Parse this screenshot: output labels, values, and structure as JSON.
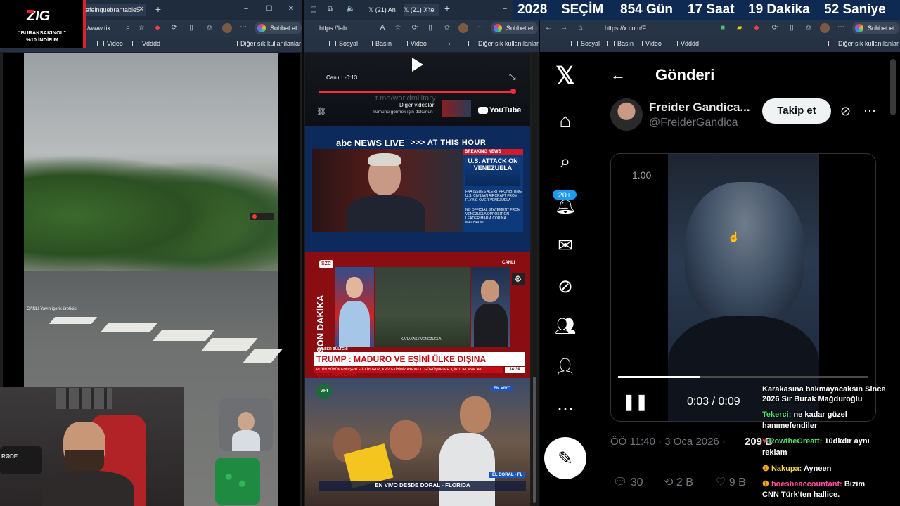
{
  "countdown": {
    "year": "2028",
    "label": "SEÇİM",
    "days": "854 Gün",
    "hours": "17 Saat",
    "minutes": "19 Dakika",
    "seconds": "52 Saniye"
  },
  "promo": {
    "logo": "ZIG",
    "code": "\"BURAKSAKINOL\"",
    "discount": "%10 İNDİRİM"
  },
  "window1": {
    "tab_title": "afeinquebrantable5",
    "url": "/www.tik...",
    "copilot_label": "Sohbet et",
    "bookmarks": {
      "video": "Video",
      "vdddd": "Vdddd",
      "other": "Diğer sık kullanılanlar"
    },
    "live_caption": "CANLI Yayın içerik üreticisi"
  },
  "window2": {
    "tabs": [
      "(21) An",
      "(21) X'te"
    ],
    "url": "https://lab...",
    "copilot_label": "Sohbet et",
    "bookmarks": {
      "sosyal": "Sosyal",
      "basin": "Basın",
      "video": "Video",
      "other": "Diğer sık kullanılanlar"
    },
    "youtube": {
      "live_status": "Canlı · -0:13",
      "more_videos": "Diğer videolar",
      "more_sub": "Tümünü görmek için dokunun",
      "brand": "YouTube",
      "watermark": "t.me/worldmilitary"
    },
    "abc": {
      "brand": "abc NEWS LIVE",
      "banner": ">>> AT THIS HOUR",
      "breaking": "BREAKING NEWS",
      "headline": "U.S. ATTACK ON VENEZUELA",
      "bullet1": "FAA ISSUES ALERT PROHIBITING U.S. CIVILIAN AIRCRAFT FROM FLYING OVER VENEZUELA",
      "bullet2": "NO OFFICIAL STATEMENT FROM VENEZUELA OPPOSITION LEADER MARIA CORINA MACHADO"
    },
    "szc": {
      "logo": "SZC",
      "live": "CANLI",
      "side": "SON DAKİKA",
      "bulletin": "HABER BÜLTENİ",
      "headline": "TRUMP : MADURO VE EŞİNİ ÜLKE DIŞINA ÇIKARDIK",
      "ticker": "PUTİN BÜYÜK ENDİŞEYLE İZLİYORUZ, KRİZ EKİBİMİZ AYRINTILI GÖRÜŞMELER İÇİN TOPLANACAK",
      "time": "14:39",
      "location": "KARAKAS / VENEZUELA"
    },
    "vpi": {
      "logo": "VPI",
      "live": "EN VIVO",
      "place": "EL DORAL - FL",
      "caption": "EN VIVO DESDE DORAL - FLORIDA"
    }
  },
  "window3": {
    "url": "https://x.com/F...",
    "copilot_label": "Sohbet et",
    "bookmarks": {
      "sosyal": "Sosyal",
      "basin": "Basın",
      "video": "Video",
      "vdddd": "Vdddd",
      "other": "Diğer sık kullanılanlar"
    },
    "nav_badge": "20+",
    "header": "Gönderi",
    "author_name": "Freider Gandica...",
    "author_handle": "@FreiderGandica",
    "follow_label": "Takip et",
    "speed": "1.00",
    "time": "0:03 / 0:09",
    "progress": 0.33,
    "timestamp": "ÖÖ 11:40 · 3 Oca 2026 ·",
    "views": "209 B",
    "replies": "30",
    "reposts": "2 B",
    "likes": "9 B"
  },
  "chat": [
    {
      "user": "",
      "text": "Karakasına bakmayacaksın Since",
      "color": "#ffffff"
    },
    {
      "user": "",
      "text": "2026 Sir Burak Mağduroğlu",
      "color": "#ffffff"
    },
    {
      "user": "Tekerci:",
      "text": "ne kadar güzel",
      "color": "#4ee06a"
    },
    {
      "user": "",
      "text": "hanımefendiler",
      "color": "#ffffff"
    },
    {
      "user": "RowtheGreatt:",
      "text": "10dkdır aynı",
      "color": "#4ee06a"
    },
    {
      "user": "",
      "text": "reklam",
      "color": "#ffffff"
    },
    {
      "user": "Nakupa:",
      "text": "Ayneen",
      "color": "#f3d34a"
    },
    {
      "user": "hoesheaccountant:",
      "text": "Bizim",
      "color": "#ff4fa0"
    },
    {
      "user": "",
      "text": "CNN Türk'ten hallice.",
      "color": "#ffffff"
    }
  ]
}
